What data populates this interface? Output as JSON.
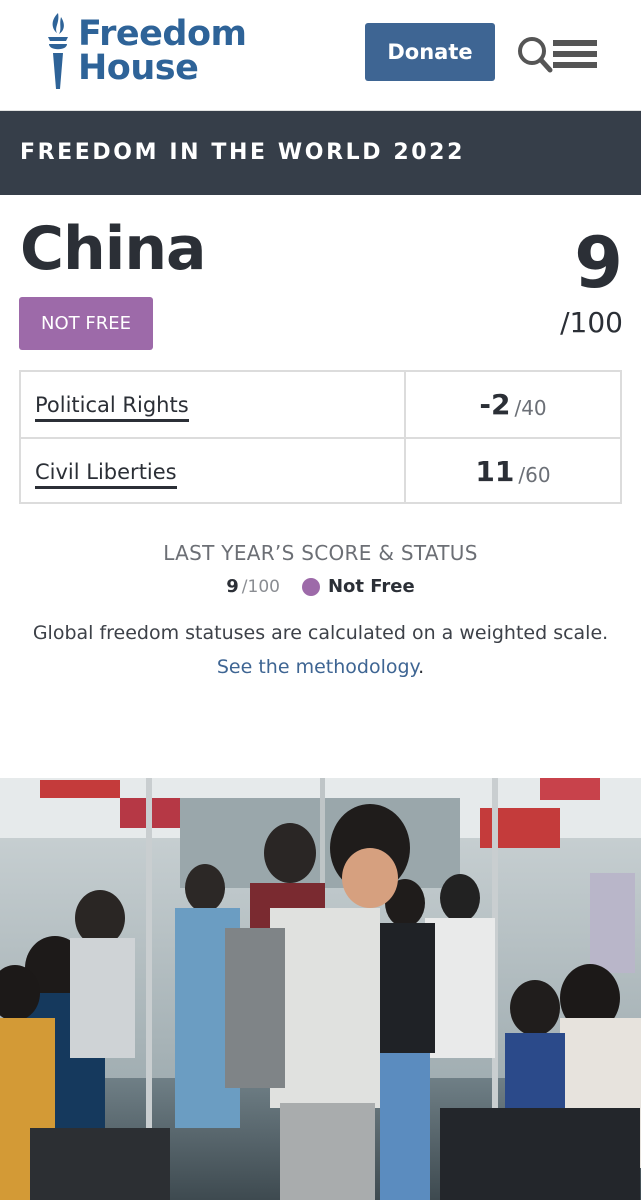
{
  "header": {
    "logo_line1": "Freedom",
    "logo_line2": "House",
    "donate_label": "Donate"
  },
  "band": {
    "title": "FREEDOM IN THE WORLD 2022"
  },
  "country": {
    "name": "China",
    "status": "NOT FREE",
    "total_score": "9",
    "total_max": "/100"
  },
  "scores": [
    {
      "label": "Political Rights",
      "score": "-2",
      "max": "/40"
    },
    {
      "label": "Civil Liberties",
      "score": "11",
      "max": "/60"
    }
  ],
  "last_year": {
    "heading": "LAST YEAR’S SCORE & STATUS",
    "score": "9",
    "max": "/100",
    "status": "Not Free"
  },
  "note": "Global freedom statuses are calculated on a weighted scale.",
  "methodology_link": "See the methodology",
  "methodology_suffix": ".",
  "colors": {
    "brand_blue": "#2e6398",
    "donate_bg": "#3e6593",
    "band_bg": "#363e49",
    "not_free": "#9d6aa9"
  },
  "icons": [
    "torch-icon",
    "search-icon",
    "menu-icon"
  ]
}
